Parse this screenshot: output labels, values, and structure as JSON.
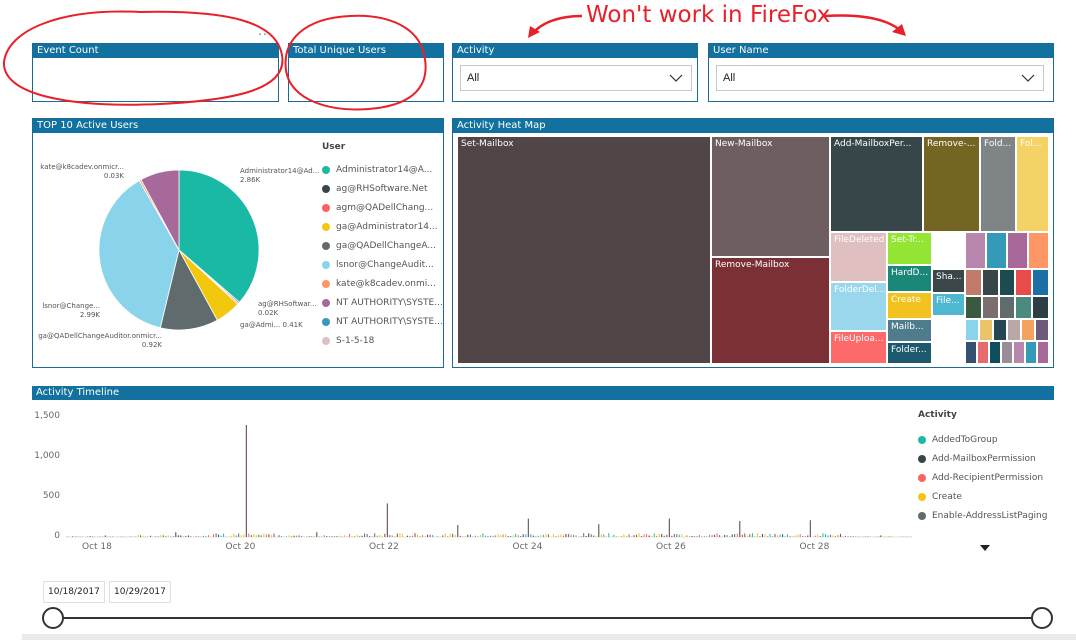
{
  "annotation": "Won't work in FireFox",
  "more_options": "...",
  "tiles": {
    "event_count": "Event Count",
    "total_unique_users": "Total Unique Users",
    "activity": "Activity",
    "user_name": "User Name",
    "top10": "TOP 10 Active Users",
    "heatmap": "Activity Heat Map",
    "timeline": "Activity Timeline"
  },
  "filters": {
    "activity_value": "All",
    "user_name_value": "All"
  },
  "top10": {
    "legend_title": "User",
    "legend": [
      {
        "label": "Administrator14@A...",
        "color": "#1ab9a6"
      },
      {
        "label": "ag@RHSoftware.Net",
        "color": "#374649"
      },
      {
        "label": "agm@QADellChang...",
        "color": "#fd625e"
      },
      {
        "label": "ga@Administrator14...",
        "color": "#f2c80f"
      },
      {
        "label": "ga@QADellChangeA...",
        "color": "#5f6b6d"
      },
      {
        "label": "lsnor@ChangeAudit...",
        "color": "#8ad4eb"
      },
      {
        "label": "kate@k8cadev.onmi...",
        "color": "#fe9666"
      },
      {
        "label": "NT AUTHORITY\\SYSTE...",
        "color": "#a66999"
      },
      {
        "label": "NT AUTHORITY\\SYSTE...",
        "color": "#3599b8"
      },
      {
        "label": "S-1-5-18",
        "color": "#dfbfbf"
      }
    ],
    "pie_labels": {
      "kate_name": "kate@k8cadev.onmicr...",
      "kate_value": "0.03K",
      "admin_name": "Administrator14@Ad...",
      "admin_value": "2.86K",
      "ag_name": "ag@RHSoftwar...",
      "ag_value": "0.02K",
      "gaadmi_name": "ga@Admi...",
      "gaadmi_value": "0.41K",
      "lsnor_name": "lsnor@Change...",
      "lsnor_value": "2.99K",
      "gaqa_name": "ga@QADellChangeAuditor.onmicr...",
      "gaqa_value": "0.92K"
    },
    "chart_data": {
      "type": "pie",
      "slices": [
        {
          "label": "Administrator14@Ad...",
          "value": 2.86,
          "color": "#1ab9a6"
        },
        {
          "label": "ag@RHSoftwar...",
          "value": 0.02,
          "color": "#374649"
        },
        {
          "label": "agm@QADellChang...",
          "value": 0.02,
          "color": "#fd625e"
        },
        {
          "label": "ga@Admi...",
          "value": 0.41,
          "color": "#f2c80f"
        },
        {
          "label": "ga@QADellChangeAuditor.onmicr...",
          "value": 0.92,
          "color": "#5f6b6d"
        },
        {
          "label": "lsnor@Change...",
          "value": 2.99,
          "color": "#8ad4eb"
        },
        {
          "label": "kate@k8cadev.onmicr...",
          "value": 0.03,
          "color": "#fe9666"
        },
        {
          "label": "NT AUTHORITY\\SYSTE...",
          "value": 0.62,
          "color": "#a66999"
        }
      ],
      "unit": "K"
    }
  },
  "heatmap": {
    "cells": [
      {
        "label": "Set-Mailbox",
        "color": "#524547"
      },
      {
        "label": "New-Mailbox",
        "color": "#6e5e5f"
      },
      {
        "label": "Remove-Mailbox",
        "color": "#7b3035"
      },
      {
        "label": "Add-MailboxPer...",
        "color": "#374649"
      },
      {
        "label": "Remove-...",
        "color": "#756522"
      },
      {
        "label": "Fold...",
        "color": "#7f8486"
      },
      {
        "label": "Fol...",
        "color": "#f3d365"
      },
      {
        "label": "FileDeleted",
        "color": "#dfbfbf"
      },
      {
        "label": "Set-Tr...",
        "color": "#94e534"
      },
      {
        "label": "FolderDel...",
        "color": "#9ad7ec"
      },
      {
        "label": "HardD...",
        "color": "#1b8779"
      },
      {
        "label": "Create",
        "color": "#f2c21e"
      },
      {
        "label": "FileUploa...",
        "color": "#fd6a6a"
      },
      {
        "label": "Mailb...",
        "color": "#4f7c8d"
      },
      {
        "label": "Folder...",
        "color": "#1e5a6e"
      },
      {
        "label": "Sha...",
        "color": "#3a4648"
      },
      {
        "label": "File...",
        "color": "#4db8d0"
      }
    ]
  },
  "timeline": {
    "legend_title": "Activity",
    "legend": [
      {
        "label": "AddedToGroup",
        "color": "#1ab9a6"
      },
      {
        "label": "Add-MailboxPermission",
        "color": "#374649"
      },
      {
        "label": "Add-RecipientPermission",
        "color": "#fd625e"
      },
      {
        "label": "Create",
        "color": "#f2c80f"
      },
      {
        "label": "Enable-AddressListPaging",
        "color": "#5f6b6d"
      }
    ],
    "y_ticks": [
      "1,500",
      "1,000",
      "500",
      "0"
    ],
    "x_ticks": [
      "Oct 18",
      "Oct 20",
      "Oct 22",
      "Oct 24",
      "Oct 26",
      "Oct 28"
    ],
    "chart_data": {
      "type": "bar",
      "xlabel": "",
      "ylabel": "",
      "ylim": [
        0,
        1500
      ],
      "categories": [
        "2017-10-18",
        "2017-10-19",
        "2017-10-20",
        "2017-10-21",
        "2017-10-22",
        "2017-10-23",
        "2017-10-24",
        "2017-10-25",
        "2017-10-26",
        "2017-10-27",
        "2017-10-28",
        "2017-10-29"
      ],
      "peaks": [
        20,
        60,
        1400,
        60,
        420,
        150,
        230,
        160,
        230,
        200,
        210,
        20
      ]
    },
    "scroll_icon": "triangle-down-icon"
  },
  "slider": {
    "start_date": "10/18/2017",
    "end_date": "10/29/2017"
  }
}
